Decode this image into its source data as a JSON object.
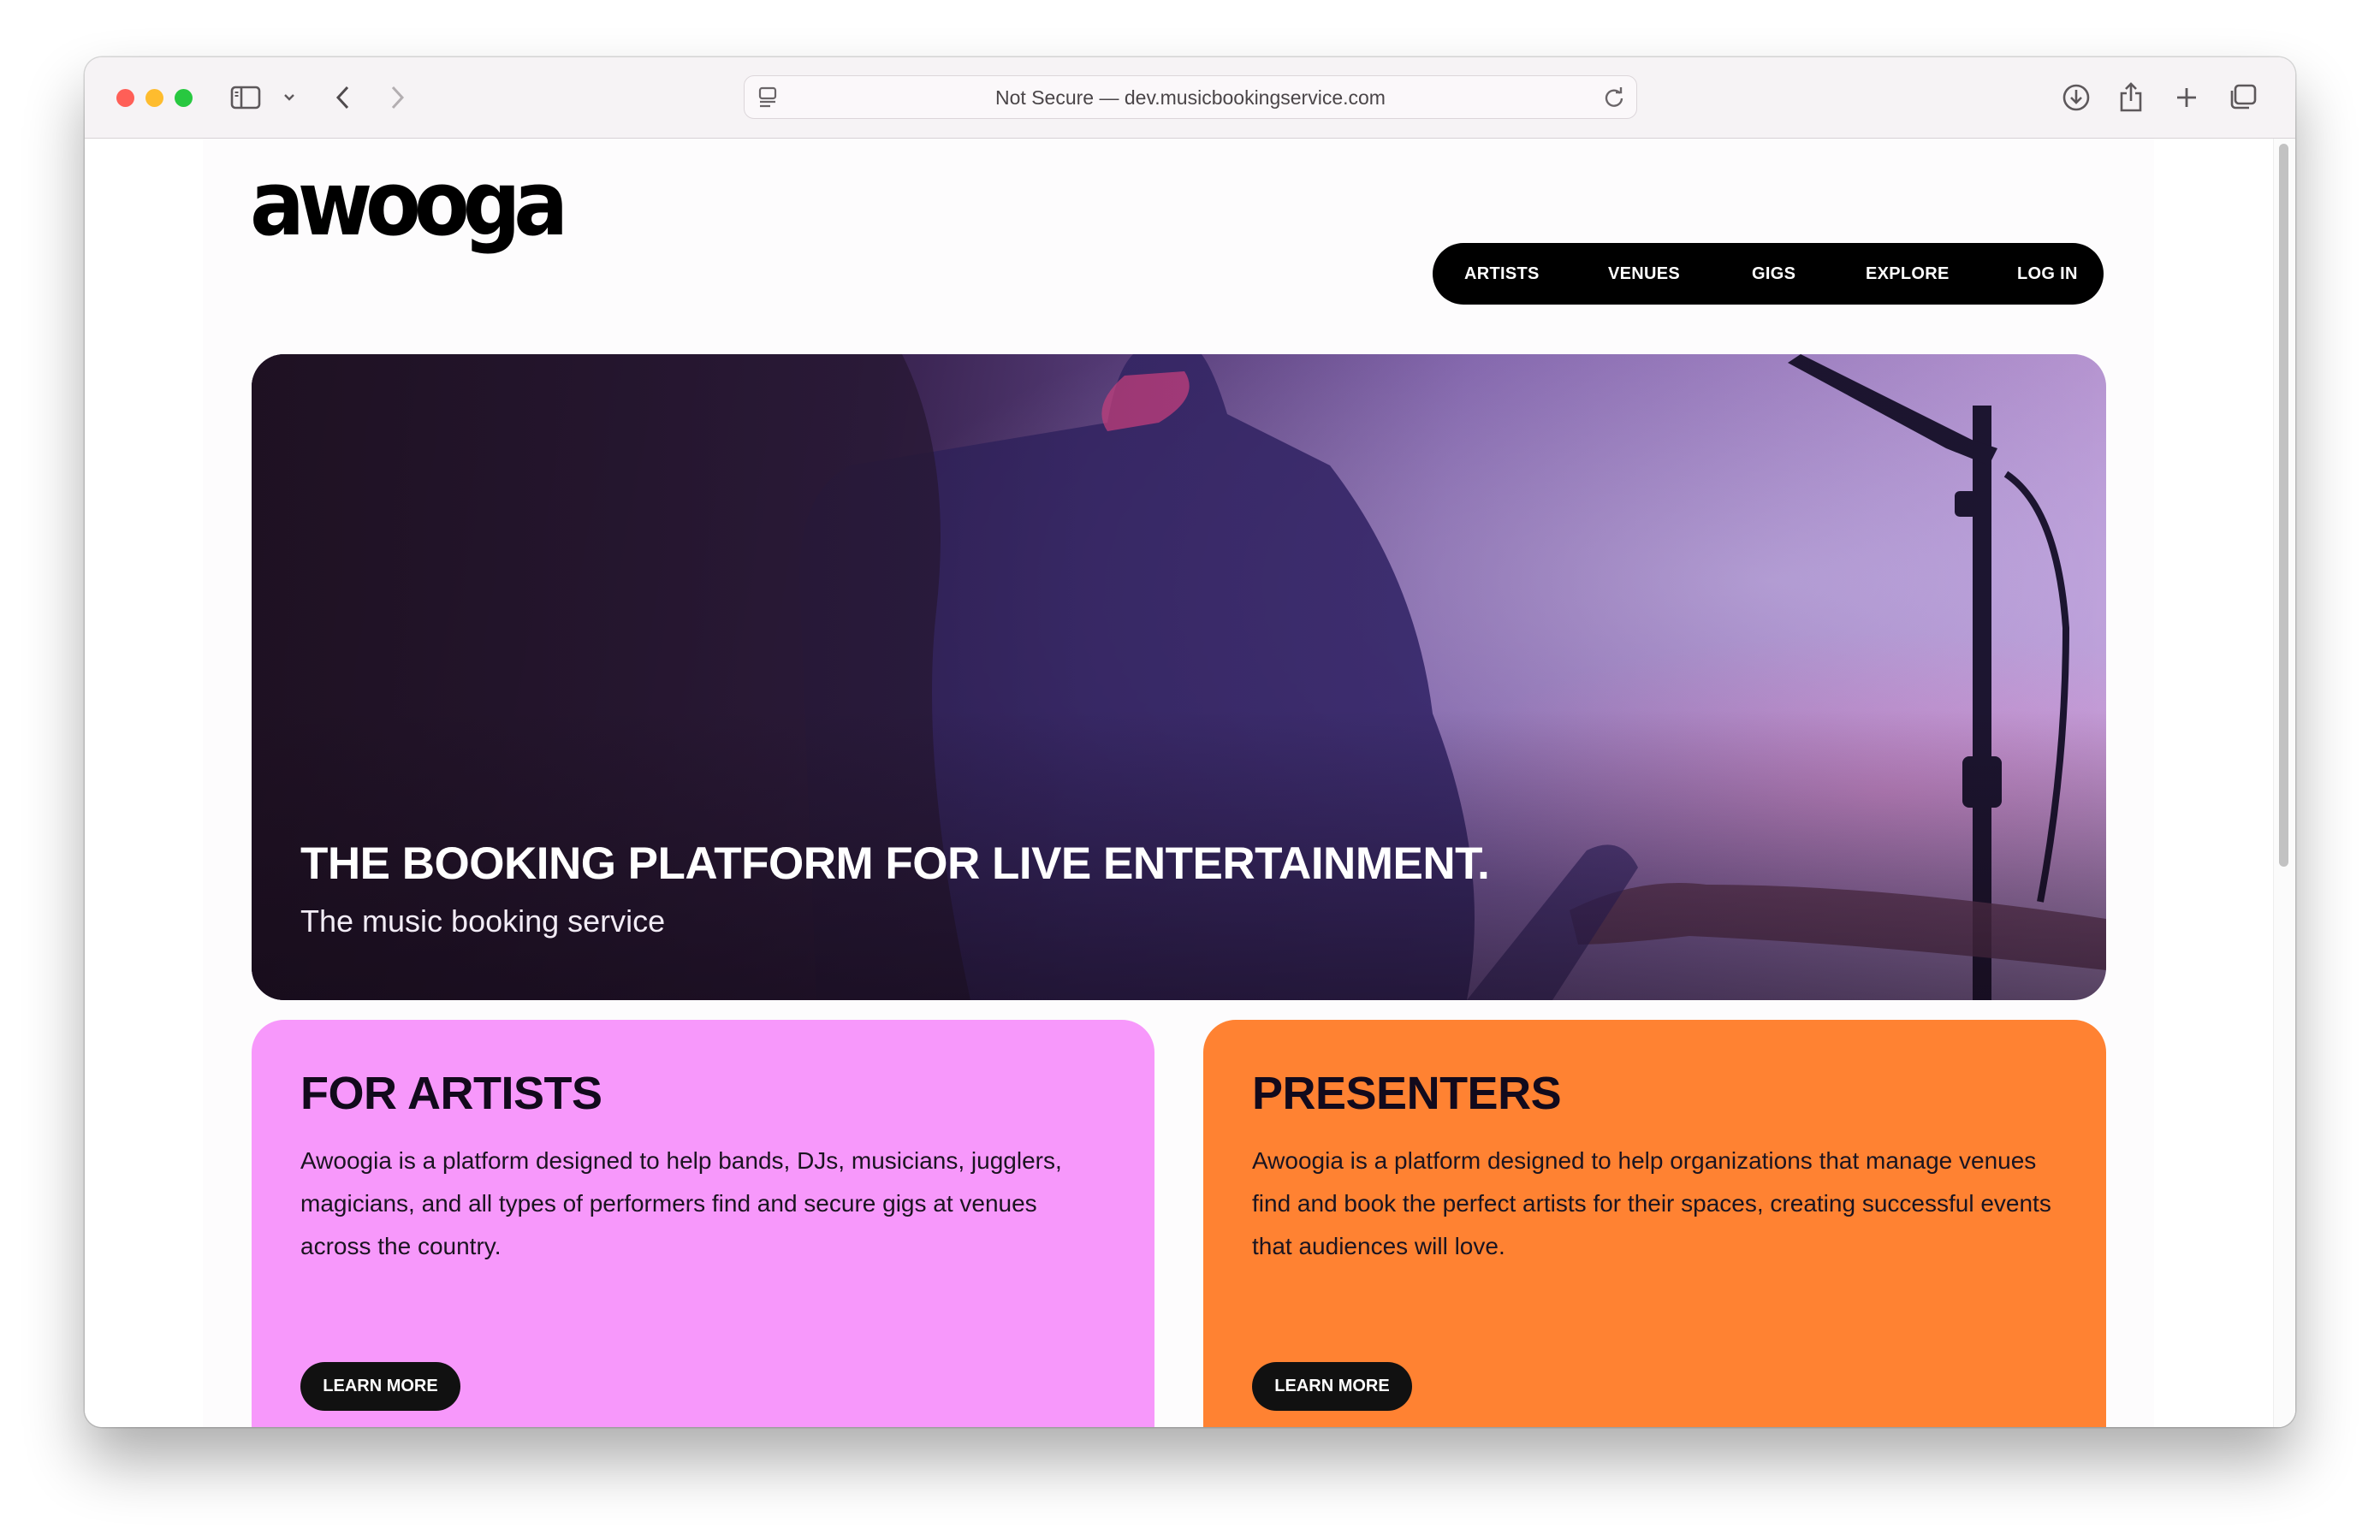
{
  "browser": {
    "url_text": "Not Secure — dev.musicbookingservice.com"
  },
  "site": {
    "logo_text": "awooga"
  },
  "nav": {
    "artists": "ARTISTS",
    "venues": "VENUES",
    "gigs": "GIGS",
    "explore": "EXPLORE",
    "login": "LOG IN"
  },
  "hero": {
    "title": "THE BOOKING PLATFORM FOR LIVE ENTERTAINMENT.",
    "subtitle": "The music booking service"
  },
  "cards": {
    "artists": {
      "title": "FOR ARTISTS",
      "text": "Awoogia is a platform designed to help bands, DJs, musicians, jugglers, magicians, and all types of performers find and secure gigs at venues across the country.",
      "button": "LEARN MORE",
      "color": "#f798fb"
    },
    "presenters": {
      "title": "PRESENTERS",
      "text": "Awoogia is a platform designed to help organizations that manage venues find and book the perfect artists for their spaces, creating successful events that audiences will love.",
      "button": "LEARN MORE",
      "color": "#ff8232"
    }
  }
}
